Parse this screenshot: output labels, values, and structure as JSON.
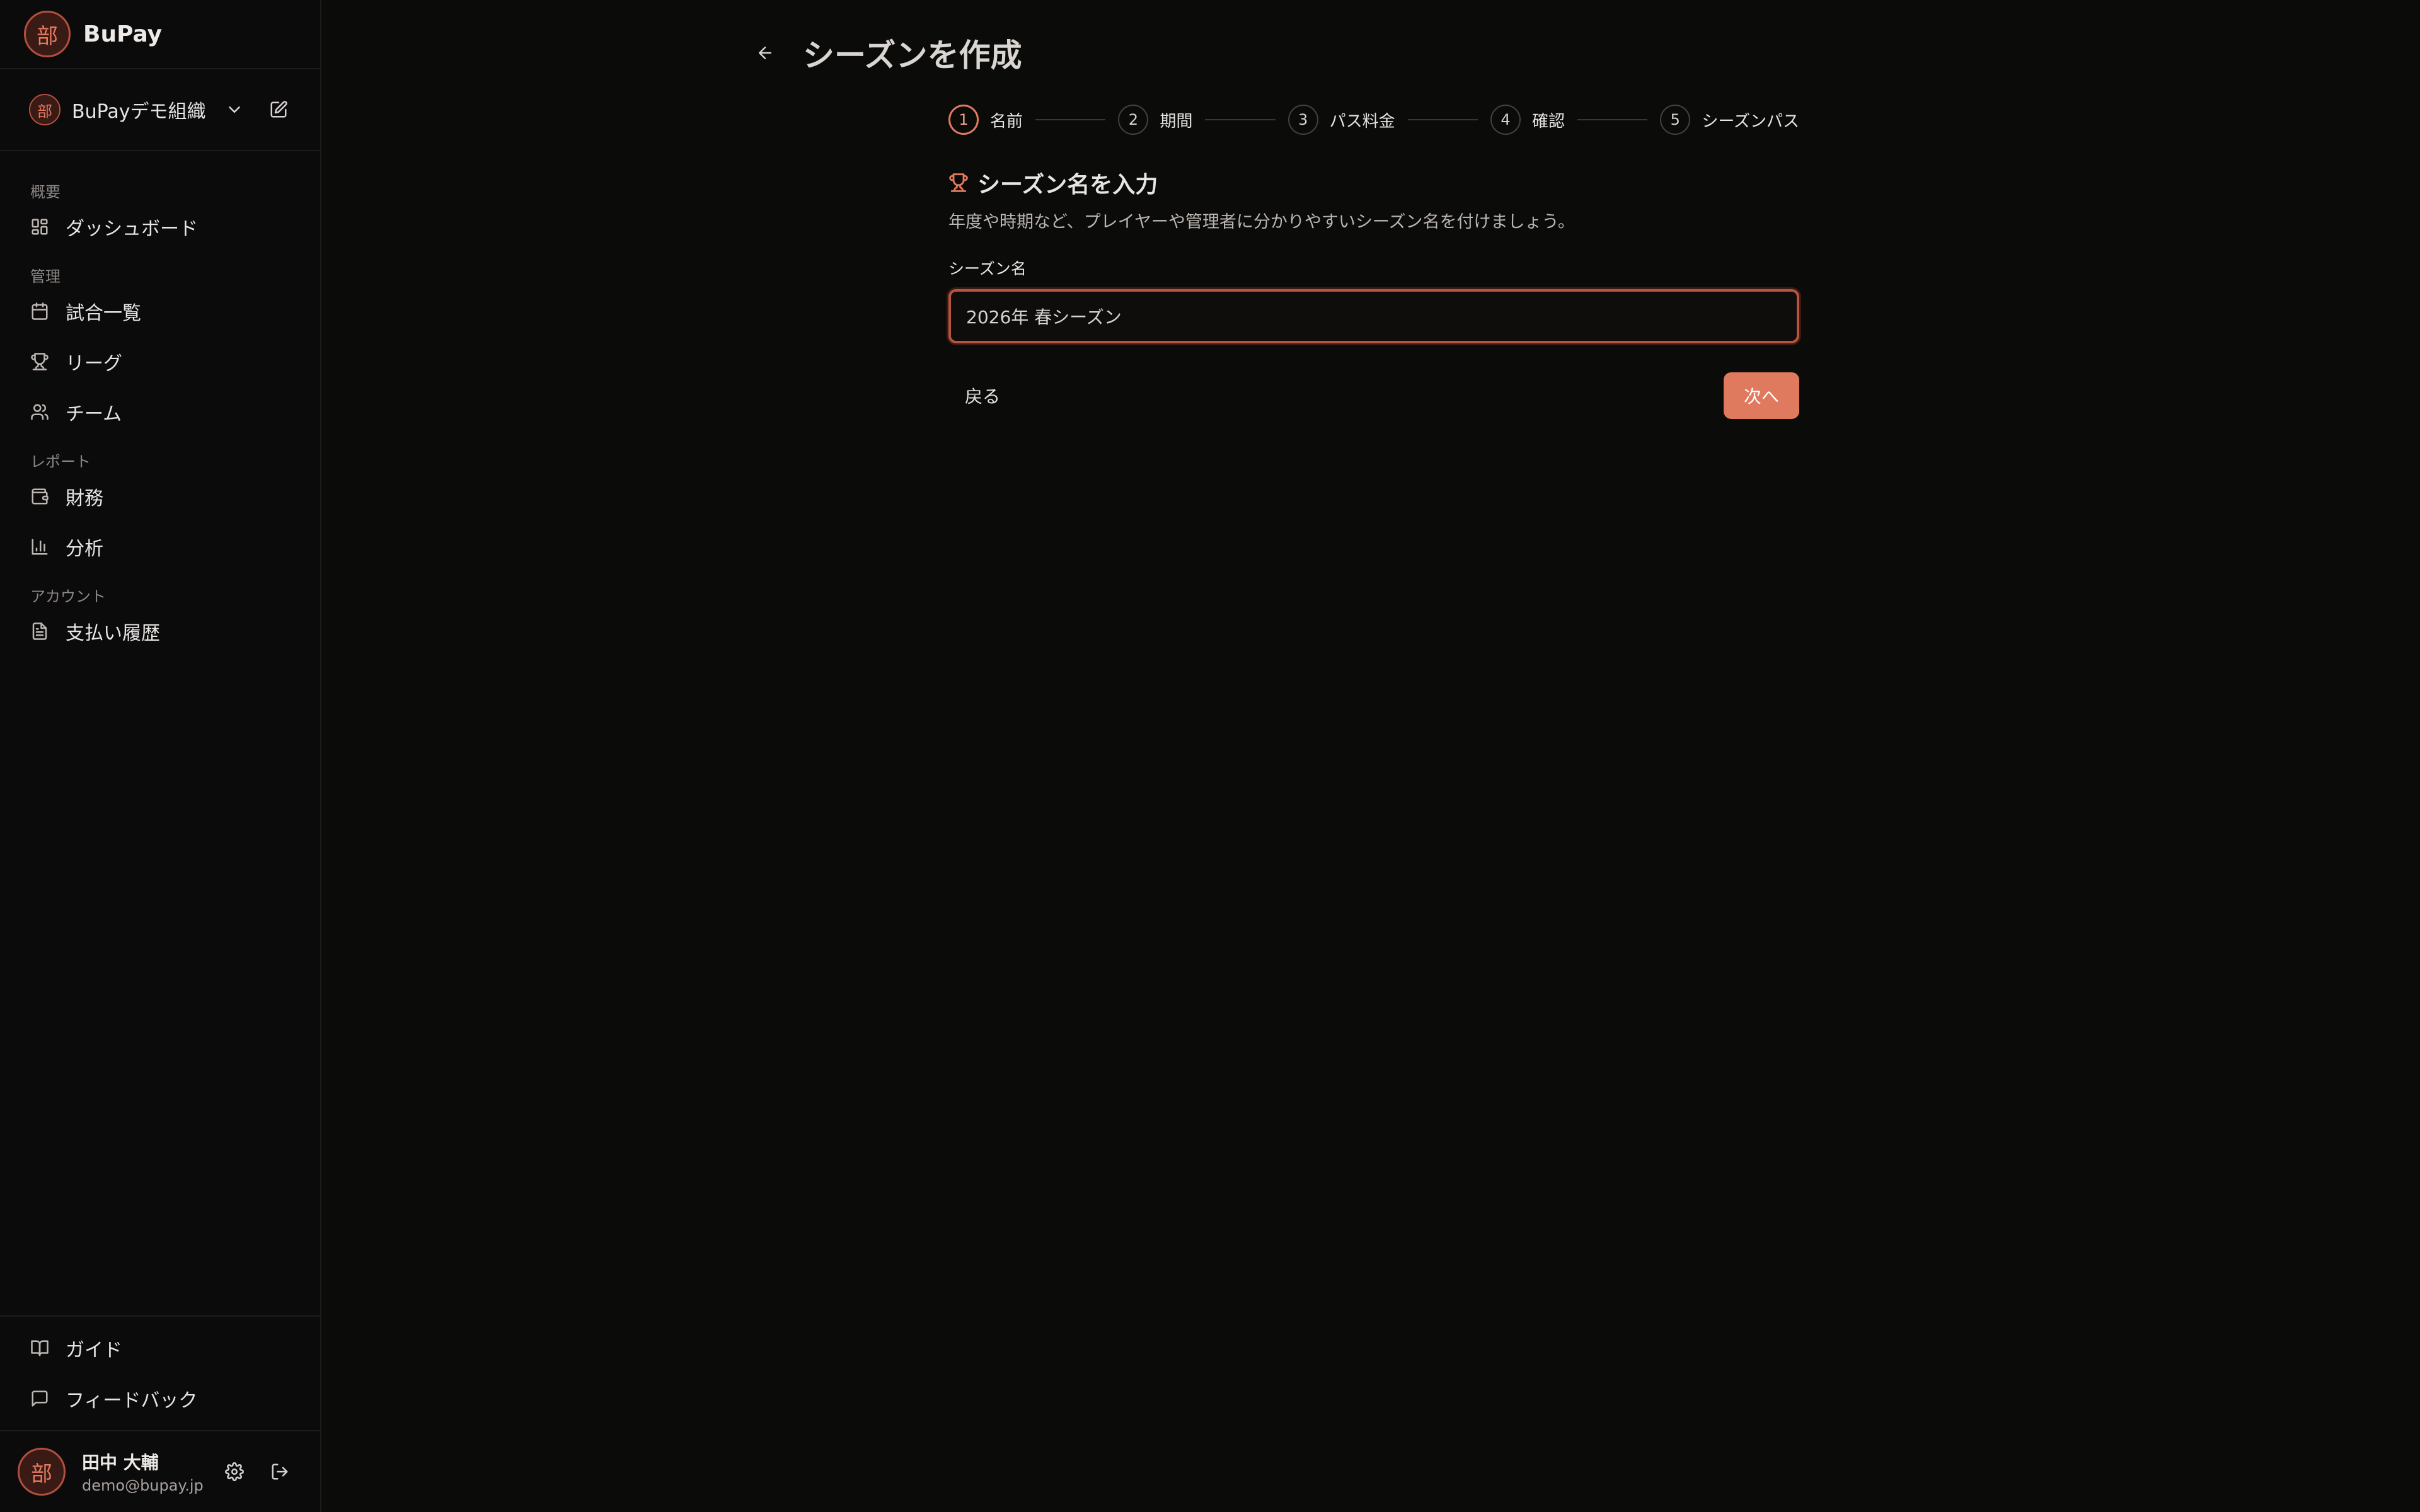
{
  "brand": {
    "name": "BuPay",
    "logo_char": "部"
  },
  "org": {
    "name": "BuPayデモ組織"
  },
  "nav": {
    "groups": [
      {
        "label": "概要",
        "items": [
          {
            "label": "ダッシュボード",
            "icon": "dashboard-icon"
          }
        ]
      },
      {
        "label": "管理",
        "items": [
          {
            "label": "試合一覧",
            "icon": "calendar-icon"
          },
          {
            "label": "リーグ",
            "icon": "trophy-icon"
          },
          {
            "label": "チーム",
            "icon": "users-icon"
          }
        ]
      },
      {
        "label": "レポート",
        "items": [
          {
            "label": "財務",
            "icon": "wallet-icon"
          },
          {
            "label": "分析",
            "icon": "bar-chart-icon"
          }
        ]
      },
      {
        "label": "アカウント",
        "items": [
          {
            "label": "支払い履歴",
            "icon": "document-icon"
          }
        ]
      }
    ],
    "bottom": [
      {
        "label": "ガイド",
        "icon": "book-icon"
      },
      {
        "label": "フィードバック",
        "icon": "message-icon"
      }
    ]
  },
  "user": {
    "name": "田中 大輔",
    "email": "demo@bupay.jp",
    "avatar_char": "部"
  },
  "page": {
    "title": "シーズンを作成"
  },
  "wizard": {
    "steps": [
      {
        "num": "1",
        "label": "名前",
        "active": true
      },
      {
        "num": "2",
        "label": "期間",
        "active": false
      },
      {
        "num": "3",
        "label": "パス料金",
        "active": false
      },
      {
        "num": "4",
        "label": "確認",
        "active": false
      },
      {
        "num": "5",
        "label": "シーズンパス",
        "active": false
      }
    ],
    "section_title": "シーズン名を入力",
    "description": "年度や時期など、プレイヤーや管理者に分かりやすいシーズン名を付けましょう。",
    "field_label": "シーズン名",
    "field_value": "2026年 春シーズン",
    "back_label": "戻る",
    "next_label": "次へ"
  },
  "colors": {
    "accent": "#e07a5f",
    "background": "#0b0b0a",
    "border": "#1e1c1b"
  }
}
